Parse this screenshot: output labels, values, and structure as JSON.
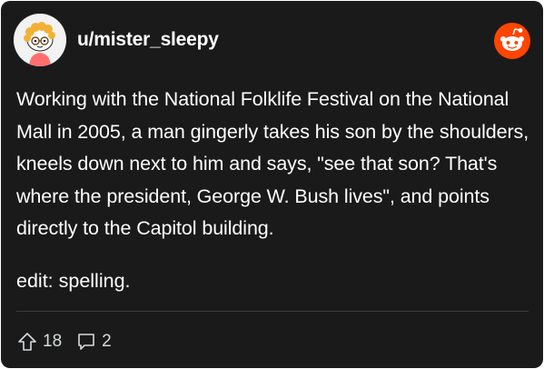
{
  "post": {
    "username": "u/mister_sleepy",
    "body": "Working with the National Folklife Festival on the National Mall in 2005, a man gingerly takes his son by the shoulders, kneels down next to him and says, \"see that son? That's where the president, George W. Bush lives\", and points directly to the Capitol building.",
    "edit": "edit: spelling.",
    "upvotes": "18",
    "comments": "2"
  },
  "icons": {
    "avatar": "snoo-avatar",
    "logo": "reddit-logo-icon",
    "upvote": "upvote-arrow-icon",
    "comment": "comment-bubble-icon"
  },
  "colors": {
    "card_background": "#1a1a1b",
    "text": "#ffffff",
    "meta_text": "#d7dadc",
    "reddit_orange": "#ff4500",
    "divider": "#3a3a3c"
  }
}
